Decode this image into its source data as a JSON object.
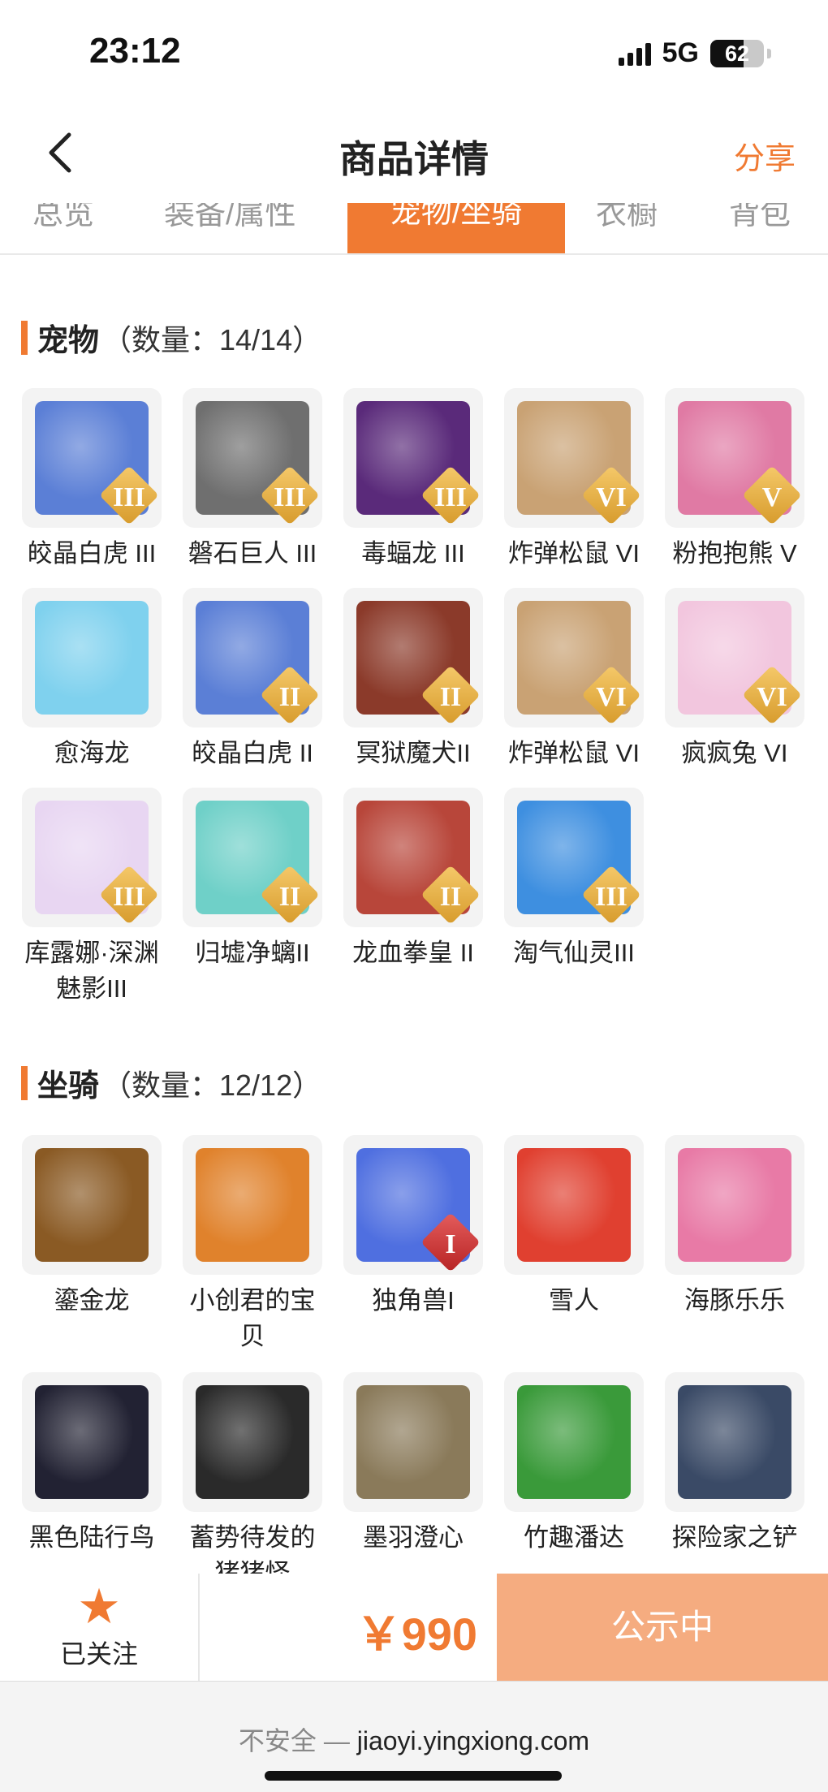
{
  "status_bar": {
    "time": "23:12",
    "network": "5G",
    "battery": "62"
  },
  "header": {
    "title": "商品详情",
    "share": "分享"
  },
  "tabs": [
    {
      "label": "总览"
    },
    {
      "label": "装备/属性"
    },
    {
      "label": "宠物/坐骑",
      "active": true
    },
    {
      "label": "衣橱"
    },
    {
      "label": "背包"
    }
  ],
  "pets": {
    "title": "宠物",
    "count": "（数量：14/14）",
    "items": [
      {
        "name": "皎晶白虎 III",
        "badge": "III",
        "icon": "white-tiger-icon",
        "color": "#5b7fd6"
      },
      {
        "name": "磐石巨人 III",
        "badge": "III",
        "icon": "stone-giant-icon",
        "color": "#6f6f6f"
      },
      {
        "name": "毒蝠龙 III",
        "badge": "III",
        "icon": "bat-dragon-icon",
        "color": "#5a2a7a"
      },
      {
        "name": "炸弹松鼠 VI",
        "badge": "VI",
        "icon": "squirrel-icon",
        "color": "#c9a274"
      },
      {
        "name": "粉抱抱熊 V",
        "badge": "V",
        "icon": "pink-bear-icon",
        "color": "#e07aa4"
      },
      {
        "name": "愈海龙",
        "badge": "",
        "icon": "sea-dragon-icon",
        "color": "#7fd1ee"
      },
      {
        "name": "皎晶白虎 II",
        "badge": "II",
        "icon": "white-tiger-icon",
        "color": "#5b7fd6"
      },
      {
        "name": "冥狱魔犬II",
        "badge": "II",
        "icon": "hellhound-icon",
        "color": "#8b3a2a"
      },
      {
        "name": "炸弹松鼠 VI",
        "badge": "VI",
        "icon": "squirrel-icon",
        "color": "#c9a274"
      },
      {
        "name": "疯疯兔 VI",
        "badge": "VI",
        "icon": "rabbit-icon",
        "color": "#f2c6de"
      },
      {
        "name": "库露娜·深渊魅影III",
        "badge": "III",
        "icon": "kuluna-icon",
        "color": "#e8d6f2"
      },
      {
        "name": "归墟净螭II",
        "badge": "II",
        "icon": "jade-dragon-icon",
        "color": "#6fd0c8"
      },
      {
        "name": "龙血拳皇 II",
        "badge": "II",
        "icon": "boxer-icon",
        "color": "#b8463a"
      },
      {
        "name": "淘气仙灵III",
        "badge": "III",
        "icon": "blue-puppy-icon",
        "color": "#3e8fe0"
      }
    ]
  },
  "mounts": {
    "title": "坐骑",
    "count": "（数量：12/12）",
    "items": [
      {
        "name": "鎏金龙",
        "badge": "",
        "icon": "golden-dragon-icon",
        "color": "#8a5a24"
      },
      {
        "name": "小创君的宝贝",
        "badge": "",
        "icon": "phoenix-icon",
        "color": "#e0822c"
      },
      {
        "name": "独角兽I",
        "badge": "I",
        "badge_style": "red",
        "icon": "unicorn-icon",
        "color": "#4f6fe0"
      },
      {
        "name": "雪人",
        "badge": "",
        "icon": "snowman-icon",
        "color": "#e04030"
      },
      {
        "name": "海豚乐乐",
        "badge": "",
        "icon": "dolphin-icon",
        "color": "#e87aa6"
      },
      {
        "name": "黑色陆行鸟",
        "badge": "",
        "icon": "black-bird-icon",
        "color": "#222233"
      },
      {
        "name": "蓄势待发的猪猪怪",
        "badge": "",
        "icon": "pig-icon",
        "color": "#2a2a2a"
      },
      {
        "name": "墨羽澄心",
        "badge": "",
        "icon": "feather-blade-icon",
        "color": "#8a7a5a"
      },
      {
        "name": "竹趣潘达",
        "badge": "",
        "icon": "panda-icon",
        "color": "#3a9a3a"
      },
      {
        "name": "探险家之铲",
        "badge": "",
        "icon": "shovel-icon",
        "color": "#3a4a66"
      }
    ]
  },
  "bottom": {
    "follow": "已关注",
    "price": "￥990",
    "status": "公示中"
  },
  "browser": {
    "insecure": "不安全",
    "separator": " — ",
    "url": "jiaoyi.yingxiong.com"
  }
}
